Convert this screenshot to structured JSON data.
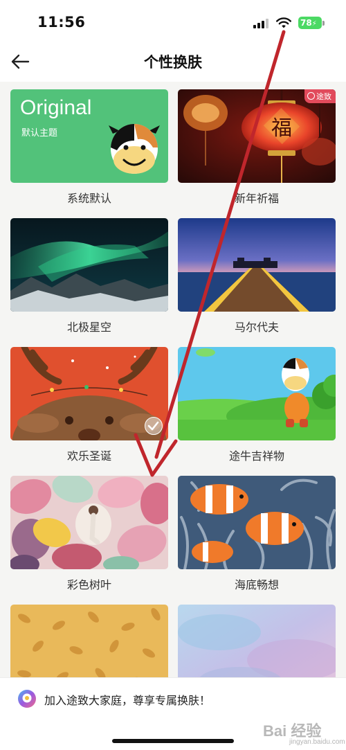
{
  "status_bar": {
    "time": "11:56",
    "battery": "78"
  },
  "header": {
    "title": "个性换肤"
  },
  "themes": [
    {
      "label": "系统默认",
      "title": "Original",
      "subtitle": "默认主题"
    },
    {
      "label": "新年祈福",
      "tag": "途致",
      "lantern_char": "福"
    },
    {
      "label": "北极星空"
    },
    {
      "label": "马尔代夫"
    },
    {
      "label": "欢乐圣诞",
      "selected": true
    },
    {
      "label": "途牛吉祥物"
    },
    {
      "label": "彩色树叶"
    },
    {
      "label": "海底畅想"
    },
    {
      "label": ""
    },
    {
      "label": ""
    }
  ],
  "banner": {
    "text": "加入途致大家庭，尊享专属换肤！"
  },
  "watermark": {
    "text": "Bai 经验",
    "sub": "jingyan.baidu.com"
  },
  "colors": {
    "default_theme_green": "#52c27a",
    "annotation_arrow": "#c0262c",
    "battery": "#4cd964",
    "tag": "#f05064"
  }
}
